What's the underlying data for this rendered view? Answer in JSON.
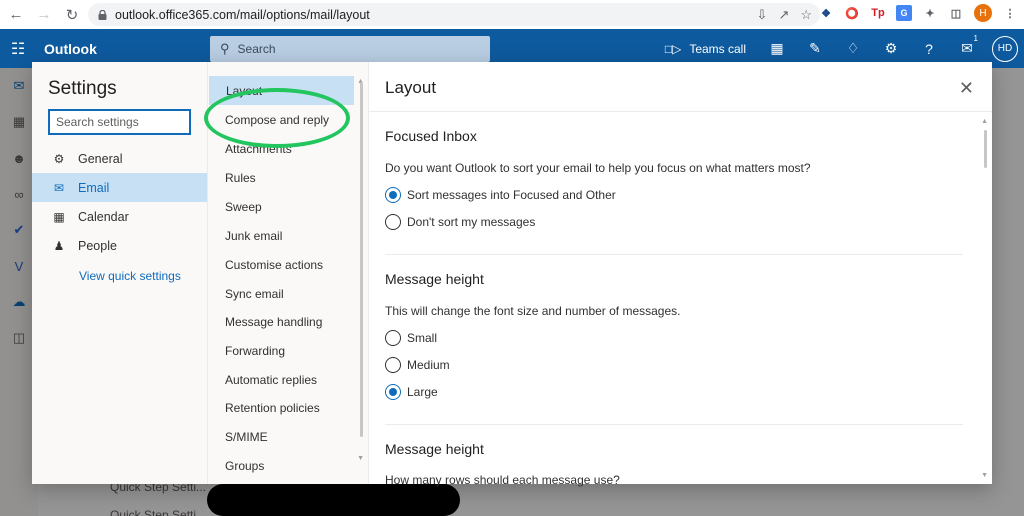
{
  "browser": {
    "url": "outlook.office365.com/mail/options/mail/layout",
    "profile_initial": "H"
  },
  "header": {
    "app_name": "Outlook",
    "search_placeholder": "Search",
    "teams_call_label": "Teams call",
    "notification_badge": "1",
    "avatar_initials": "HD"
  },
  "background": {
    "items": [
      "Quick Step Setti...",
      "Quick Step Setti..."
    ]
  },
  "settings": {
    "title": "Settings",
    "search_placeholder": "Search settings",
    "categories": [
      {
        "label": "General",
        "icon": "gear-icon"
      },
      {
        "label": "Email",
        "icon": "mail-icon"
      },
      {
        "label": "Calendar",
        "icon": "calendar-icon"
      },
      {
        "label": "People",
        "icon": "people-icon"
      }
    ],
    "quick_settings_link": "View quick settings",
    "subcategories": [
      "Layout",
      "Compose and reply",
      "Attachments",
      "Rules",
      "Sweep",
      "Junk email",
      "Customise actions",
      "Sync email",
      "Message handling",
      "Forwarding",
      "Automatic replies",
      "Retention policies",
      "S/MIME",
      "Groups"
    ]
  },
  "layout_panel": {
    "title": "Layout",
    "focused_inbox": {
      "title": "Focused Inbox",
      "question": "Do you want Outlook to sort your email to help you focus on what matters most?",
      "options": [
        "Sort messages into Focused and Other",
        "Don't sort my messages"
      ]
    },
    "message_height": {
      "title": "Message height",
      "question": "This will change the font size and number of messages.",
      "options": [
        "Small",
        "Medium",
        "Large"
      ]
    },
    "message_height_rows": {
      "title": "Message height",
      "question": "How many rows should each message use?"
    }
  },
  "colors": {
    "accent": "#0f6cbd",
    "annotation": "#22c55e"
  }
}
